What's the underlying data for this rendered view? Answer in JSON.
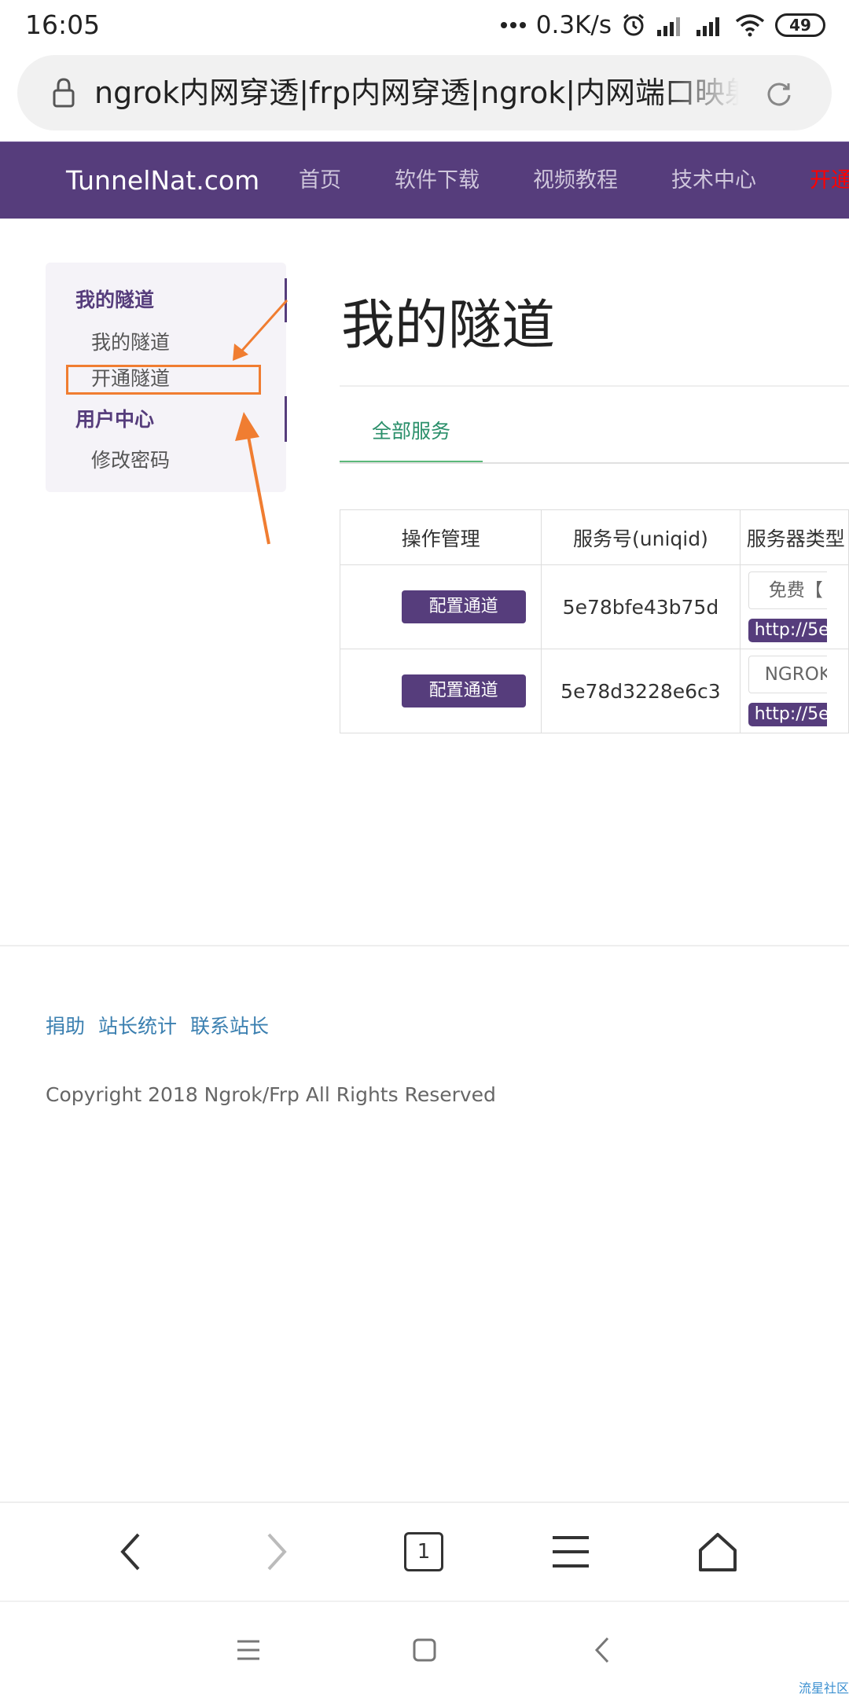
{
  "status_bar": {
    "time": "16:05",
    "net_speed": "0.3K/s",
    "battery": "49",
    "icons": [
      "dots-icon",
      "alarm-icon",
      "signal-icon",
      "signal-icon",
      "wifi-icon",
      "battery-icon"
    ]
  },
  "browser": {
    "url_title": "ngrok内网穿透|frp内网穿透|ngrok|内网端口映射",
    "tab_count": "1",
    "icons": [
      "lock-icon",
      "reload-icon",
      "back-icon",
      "forward-icon",
      "menu-icon",
      "home-icon"
    ]
  },
  "navbar": {
    "brand": "TunnelNat.com",
    "items": [
      "首页",
      "软件下载",
      "视频教程",
      "技术中心"
    ],
    "highlight": "开通隧道",
    "colors": {
      "background": "#563d7c",
      "highlight": "#ff0000"
    }
  },
  "sidebar": {
    "sections": [
      {
        "heading": "我的隧道",
        "links": [
          "我的隧道",
          "开通隧道"
        ]
      },
      {
        "heading": "用户中心",
        "links": [
          "修改密码"
        ]
      }
    ]
  },
  "main": {
    "title": "我的隧道",
    "tabs": [
      "全部服务"
    ],
    "table": {
      "headers": [
        "操作管理",
        "服务号(uniqid)",
        "服务器类型"
      ],
      "rows": [
        {
          "action": "配置通道",
          "uniqid": "5e78bfe43b75d",
          "type": "免费【",
          "url": "http://5e"
        },
        {
          "action": "配置通道",
          "uniqid": "5e78d3228e6c3",
          "type": "NGROK",
          "url": "http://5e"
        }
      ]
    }
  },
  "footer": {
    "links": [
      "捐助",
      "站长统计",
      "联系站长"
    ],
    "copyright": "Copyright 2018 Ngrok/Frp All Rights Reserved"
  },
  "watermark": "流星社区",
  "annotation": {
    "color": "#f07d31"
  }
}
